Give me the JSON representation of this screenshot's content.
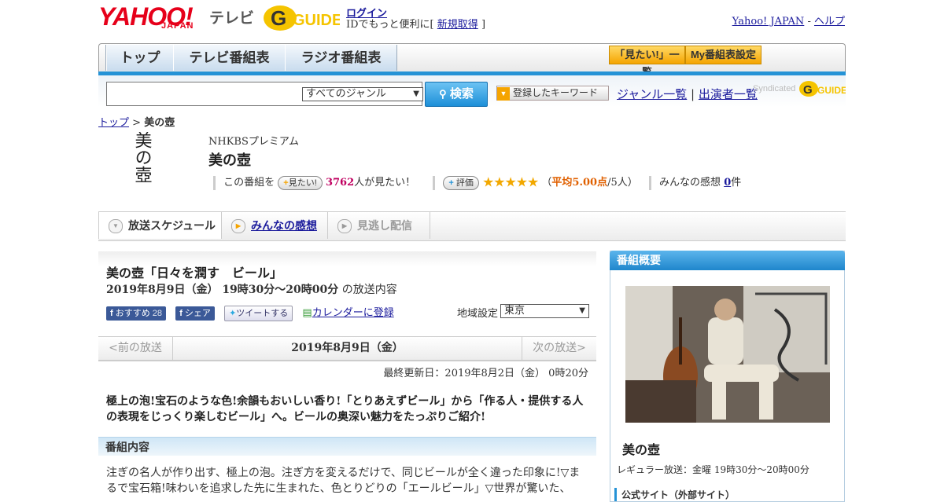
{
  "header": {
    "yahoo_logo": "YAHOO!",
    "japan_logo": "JAPAN",
    "tv_logo": "テレビ",
    "gguide_logo": "GUIDE",
    "login": "ログイン",
    "login_sub_prefix": "IDでもっと便利に[",
    "signup": "新規取得",
    "login_sub_suffix": "]",
    "yahoo_japan_link": "Yahoo! JAPAN",
    "link_sep": "-",
    "help_link": "ヘルプ"
  },
  "nav": {
    "tabs": [
      "トップ",
      "テレビ番組表",
      "ラジオ番組表"
    ],
    "want_list": "「見たい!」一覧",
    "my_guide": "My番組表設定"
  },
  "search": {
    "placeholder": "",
    "genre_selected": "すべてのジャンル",
    "search_button": "検索",
    "keyword_button": "登録したキーワード",
    "genre_list_link": "ジャンル一覧",
    "link_sep": "|",
    "performer_link": "出演者一覧",
    "syndicated": "Syndicated"
  },
  "breadcrumb": {
    "top": "トップ",
    "sep": ">",
    "current": "美の壺"
  },
  "program": {
    "logo_text": "美の壺",
    "channel": "NHKBSプレミアム",
    "title": "美の壺",
    "want_prefix": "この番組を",
    "want_button": "見たい!",
    "want_count": "3762",
    "want_suffix": "人が見たい！",
    "rating_button": "評価",
    "stars": "★★★★★",
    "rating_open": "（",
    "rating_avg": "平均5.00点",
    "rating_people": "/5人）",
    "impressions_label": "みんなの感想",
    "impressions_count": "0",
    "impressions_suffix": "件"
  },
  "subtabs": {
    "schedule": "放送スケジュール",
    "impressions": "みんなの感想",
    "catchup": "見逃し配信"
  },
  "episode": {
    "title": "美の壺「日々を潤す　ビール」",
    "date": "2019年8月9日（金） 19時30分～20時00分",
    "date_suffix": "の放送内容",
    "fb_recommend": "おすすめ",
    "fb_count": "28",
    "fb_share": "シェア",
    "tweet": "ツイートする",
    "calendar": "カレンダーに登録",
    "region_label": "地域設定",
    "region_selected": "東京",
    "prev": "<前の放送",
    "current_day": "2019年8月9日（金）",
    "next": "次の放送>",
    "updated": "最終更新日：2019年8月2日（金） 0時20分",
    "summary": "極上の泡!宝石のような色!余韻もおいしい香り!「とりあえずビール」から「作る人・提供する人の表現をじっくり楽しむビール」へ。ビールの奥深い魅力をたっぷりご紹介!",
    "content_head": "番組内容",
    "content_body": "注ぎの名人が作り出す、極上の泡。注ぎ方を変えるだけで、同じビールが全く違った印象に!▽まるで宝石箱!味わいを追求した先に生まれた、色とりどりの「エールビール」▽世界が驚いた、"
  },
  "side": {
    "head": "番組概要",
    "title": "美の壺",
    "regular": "レギュラー放送：金曜 19時30分～20時00分",
    "official": "公式サイト（外部サイト）"
  },
  "colors": {
    "accent": "#2593d6",
    "brand_red": "#e6001a",
    "star": "#f2a800",
    "count": "#c00060"
  }
}
